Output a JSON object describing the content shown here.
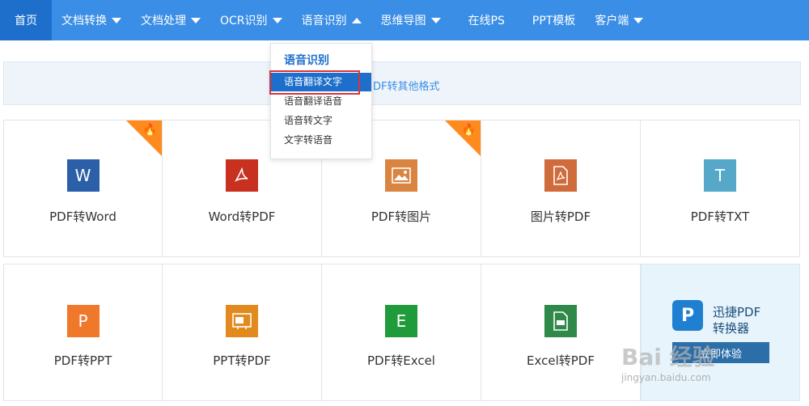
{
  "nav": {
    "items": [
      {
        "label": "首页",
        "caret": "none"
      },
      {
        "label": "文档转换",
        "caret": "down"
      },
      {
        "label": "文档处理",
        "caret": "down"
      },
      {
        "label": "OCR识别",
        "caret": "down"
      },
      {
        "label": "语音识别",
        "caret": "up"
      },
      {
        "label": "思维导图",
        "caret": "down"
      },
      {
        "label": "在线PS",
        "caret": "none"
      },
      {
        "label": "PPT模板",
        "caret": "none"
      },
      {
        "label": "客户端",
        "caret": "down"
      }
    ]
  },
  "banner": {
    "text": "DF转其他格式"
  },
  "dropdown": {
    "title": "语音识别",
    "items": [
      "语音翻译文字",
      "语音翻译语音",
      "语音转文字",
      "文字转语音"
    ],
    "active_index": 0
  },
  "tiles": [
    {
      "label": "PDF转Word",
      "icon": "W",
      "color": "#2b5fa8",
      "hot": true
    },
    {
      "label": "Word转PDF",
      "icon": "pdf-acrobat-icon",
      "color": "#c8301f",
      "hot": false
    },
    {
      "label": "PDF转图片",
      "icon": "image-icon",
      "color": "#d98441",
      "hot": true
    },
    {
      "label": "图片转PDF",
      "icon": "pdf-doc-icon",
      "color": "#d06b3b",
      "hot": false
    },
    {
      "label": "PDF转TXT",
      "icon": "T",
      "color": "#56a8c9",
      "hot": false
    },
    {
      "label": "PDF转PPT",
      "icon": "P",
      "color": "#f0782a",
      "hot": false
    },
    {
      "label": "PPT转PDF",
      "icon": "ppt-pdf-icon",
      "color": "#e28a1d",
      "hot": false
    },
    {
      "label": "PDF转Excel",
      "icon": "E",
      "color": "#1f9b3b",
      "hot": false
    },
    {
      "label": "Excel转PDF",
      "icon": "excel-pdf-icon",
      "color": "#2f8a4a",
      "hot": false
    }
  ],
  "ad": {
    "logo": "P",
    "line1": "迅捷PDF",
    "line2": "转换器",
    "button": "立即体验"
  },
  "watermark": {
    "main": "Bai 经验",
    "sub": "jingyan.baidu.com"
  }
}
